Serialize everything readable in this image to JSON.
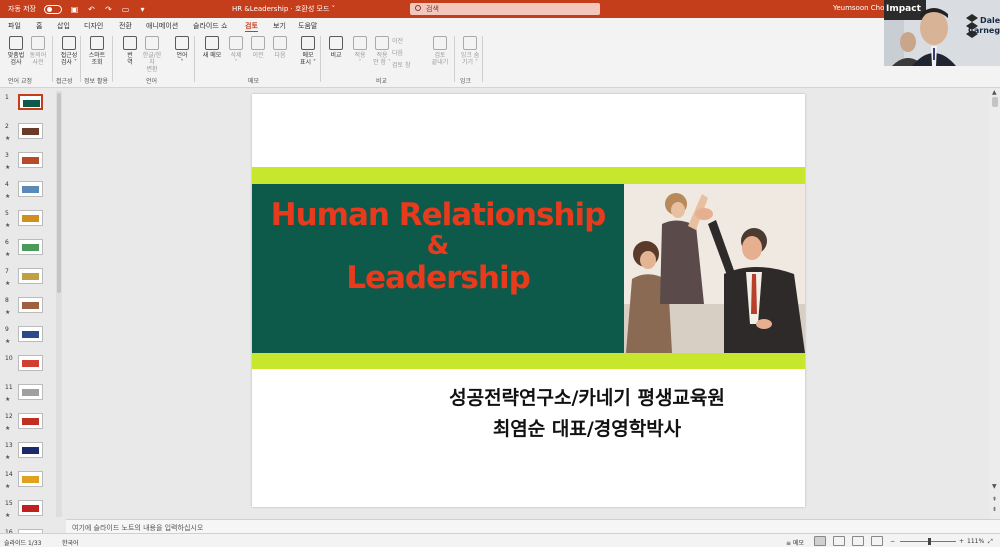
{
  "titlebar": {
    "autosave_label": "자동 저장",
    "doc_title": "HR &Leadership · 호환성 모드 ˅",
    "search_placeholder": "검색",
    "user_name": "Yeumsoon Choi"
  },
  "menu": {
    "tabs": [
      {
        "label": "파일"
      },
      {
        "label": "홈"
      },
      {
        "label": "삽입"
      },
      {
        "label": "디자인"
      },
      {
        "label": "전환"
      },
      {
        "label": "애니메이션"
      },
      {
        "label": "슬라이드 쇼"
      },
      {
        "label": "검토",
        "active": true
      },
      {
        "label": "보기"
      },
      {
        "label": "도움말"
      }
    ]
  },
  "ribbon": {
    "buttons": [
      {
        "line1": "맞춤법",
        "line2": "검사",
        "dim": false
      },
      {
        "line1": "동의어",
        "line2": "사전",
        "dim": true
      },
      {
        "line1": "접근성",
        "line2": "검사 ˅",
        "dim": false
      },
      {
        "line1": "스마트",
        "line2": "조회",
        "dim": false
      },
      {
        "line1": "번",
        "line2": "역",
        "dim": false
      },
      {
        "line1": "한글/한자",
        "line2": "변환",
        "dim": true
      },
      {
        "line1": "언어",
        "line2": "˅",
        "dim": false
      },
      {
        "line1": "새 메모",
        "line2": "",
        "dim": false
      },
      {
        "line1": "삭제",
        "line2": "˅",
        "dim": true
      },
      {
        "line1": "이전",
        "line2": "",
        "dim": true
      },
      {
        "line1": "다음",
        "line2": "",
        "dim": true
      },
      {
        "line1": "메모",
        "line2": "표시 ˅",
        "dim": false
      },
      {
        "line1": "비교",
        "line2": "",
        "dim": false
      },
      {
        "line1": "적용",
        "line2": "˅",
        "dim": true
      },
      {
        "line1": "적용",
        "line2": "안 함 ˅",
        "dim": true
      },
      {
        "line1": "검토",
        "line2": "끝내기",
        "dim": true
      },
      {
        "line1": "잉크 숨",
        "line2": "기기 ˅",
        "dim": true
      }
    ],
    "small_buttons": [
      "이전",
      "다음",
      "검토 창"
    ],
    "groups": [
      "언어 교정",
      "접근성",
      "정보 활용",
      "언어",
      "메모",
      "비교",
      "잉크"
    ]
  },
  "thumbnails": [
    {
      "num": "1",
      "star": false,
      "active": true,
      "color": "#0e5a4a"
    },
    {
      "num": "2",
      "star": true,
      "active": false,
      "color": "#6b3a2a"
    },
    {
      "num": "3",
      "star": true,
      "active": false,
      "color": "#b84a2a"
    },
    {
      "num": "4",
      "star": true,
      "active": false,
      "color": "#5a8ab8"
    },
    {
      "num": "5",
      "star": true,
      "active": false,
      "color": "#d09020"
    },
    {
      "num": "6",
      "star": true,
      "active": false,
      "color": "#4a9a5a"
    },
    {
      "num": "7",
      "star": true,
      "active": false,
      "color": "#c0a040"
    },
    {
      "num": "8",
      "star": true,
      "active": false,
      "color": "#a06040"
    },
    {
      "num": "9",
      "star": true,
      "active": false,
      "color": "#2a4a8a"
    },
    {
      "num": "10",
      "star": false,
      "active": false,
      "color": "#d04030"
    },
    {
      "num": "11",
      "star": true,
      "active": false,
      "color": "#a0a0a0"
    },
    {
      "num": "12",
      "star": true,
      "active": false,
      "color": "#c03020"
    },
    {
      "num": "13",
      "star": true,
      "active": false,
      "color": "#1a2a6a"
    },
    {
      "num": "14",
      "star": true,
      "active": false,
      "color": "#e0a020"
    },
    {
      "num": "15",
      "star": true,
      "active": false,
      "color": "#c02020"
    },
    {
      "num": "16",
      "star": false,
      "active": false,
      "color": "#888888"
    }
  ],
  "slide": {
    "title_line1": "Human Relationship",
    "title_amp": "&",
    "title_line2": "Leadership",
    "subtitle_line1": "성공전략연구소/카네기 평생교육원",
    "subtitle_line2": "최염순 대표/경영학박사"
  },
  "notes": {
    "placeholder": "여기에 슬라이드 노트의 내용을 입력하십시오"
  },
  "status": {
    "slide_count": "슬라이드 1/33",
    "language": "한국어",
    "notes_label": "메모",
    "zoom": "111%"
  },
  "webcam": {
    "banner": "Impact",
    "logo_line1": "Dale",
    "logo_line2": "Carnegie"
  },
  "colors": {
    "accent": "#c43e1c",
    "slide_green": "#0e5a4a",
    "slide_lime": "#c7e72c",
    "title_red": "#e83a1c"
  }
}
